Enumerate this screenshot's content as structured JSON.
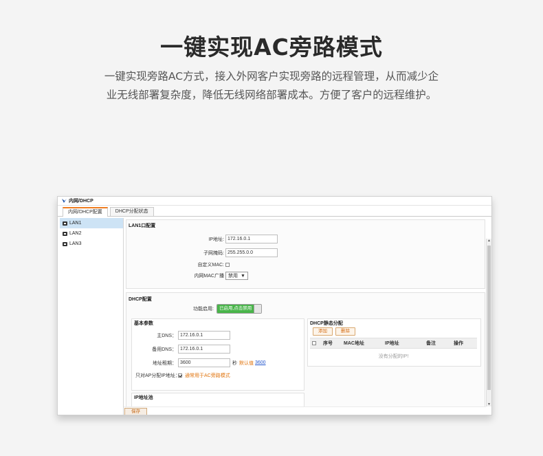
{
  "hero": {
    "title": "一键实现AC旁路模式",
    "desc_line1": "一键实现旁路AC方式，接入外网客户实现旁路的远程管理，从而减少企",
    "desc_line2": "业无线部署复杂度，降低无线网络部署成本。方便了客户的远程维护。"
  },
  "window": {
    "title": "内网/DHCP",
    "tabs": [
      {
        "label": "内网/DHCP配置",
        "active": true
      },
      {
        "label": "DHCP分配状态",
        "active": false
      }
    ],
    "sidebar": [
      "LAN1",
      "LAN2",
      "LAN3"
    ],
    "lan_section": {
      "legend": "LAN1口配置",
      "ip_label": "IP地址:",
      "ip_value": "172.16.0.1",
      "mask_label": "子网掩码:",
      "mask_value": "255.255.0.0",
      "custom_mac_label": "自定义MAC:",
      "broadcast_label": "内网MAC广播",
      "broadcast_value": "禁用"
    },
    "dhcp_section": {
      "legend": "DHCP配置",
      "enable_label": "功能启用:",
      "enable_toggle": "已启用,点击禁用",
      "basic": {
        "legend": "基本参数",
        "dns1_label": "主DNS：",
        "dns1_value": "172.16.0.1",
        "dns2_label": "备用DNS：",
        "dns2_value": "172.16.0.1",
        "lease_label": "地址租期：",
        "lease_value": "3600",
        "lease_unit": "秒",
        "lease_default_label": "默认值",
        "lease_default_value": "3600",
        "ap_only_label": "只对AP分配IP地址：",
        "ap_only_hint": "通常用于AC旁路模式"
      },
      "static": {
        "legend": "DHCP静态分配",
        "add_button": "添加",
        "delete_button": "删除",
        "columns": [
          "序号",
          "MAC地址",
          "IP地址",
          "备注",
          "操作"
        ],
        "empty_text": "没有分配的IP!"
      }
    },
    "pool_legend": "IP地址池",
    "save_button": "保存"
  },
  "colors": {
    "accent": "#ef7d20",
    "toggle_on": "#49b54a",
    "selected": "#cde3f5"
  }
}
